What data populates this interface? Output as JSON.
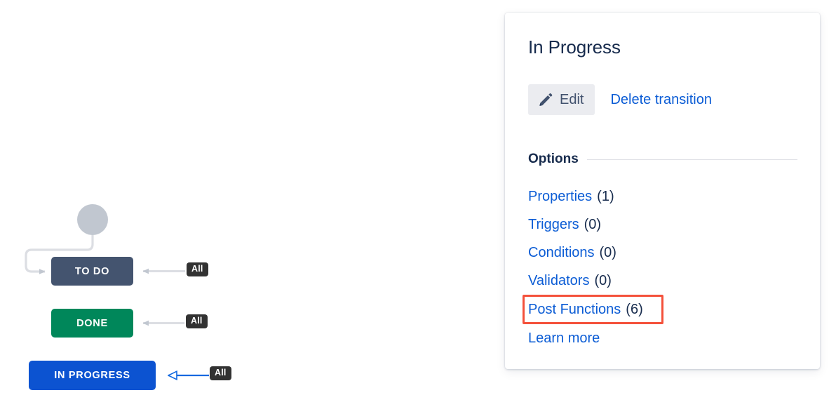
{
  "workflow": {
    "nodes": [
      {
        "id": "start",
        "label": "",
        "shape": "circle",
        "color": "#C1C7D0"
      },
      {
        "id": "todo",
        "label": "TO DO",
        "color": "#44546F"
      },
      {
        "id": "done",
        "label": "DONE",
        "color": "#00875A"
      },
      {
        "id": "inprogress",
        "label": "IN PROGRESS",
        "color": "#0C53D1",
        "selected": true
      }
    ],
    "transitions": [
      {
        "target": "todo",
        "badge": "All",
        "color": "#C1C7D0",
        "selected": false
      },
      {
        "target": "done",
        "badge": "All",
        "color": "#C1C7D0",
        "selected": false
      },
      {
        "target": "inprogress",
        "badge": "All",
        "color": "#1068E0",
        "selected": true
      }
    ]
  },
  "card": {
    "title": "In Progress",
    "edit_button_label": "Edit",
    "delete_link_label": "Delete transition",
    "options_heading": "Options",
    "options": [
      {
        "label": "Properties",
        "count": "(1)",
        "highlighted": false
      },
      {
        "label": "Triggers",
        "count": "(0)",
        "highlighted": false
      },
      {
        "label": "Conditions",
        "count": "(0)",
        "highlighted": false
      },
      {
        "label": "Validators",
        "count": "(0)",
        "highlighted": false
      },
      {
        "label": "Post Functions",
        "count": "(6)",
        "highlighted": true
      },
      {
        "label": "Learn more",
        "count": "",
        "highlighted": false
      }
    ]
  },
  "colors": {
    "link": "#0B5CD5",
    "text": "#172B4D",
    "highlight": "#F4513B",
    "badge_bg": "#323232"
  }
}
